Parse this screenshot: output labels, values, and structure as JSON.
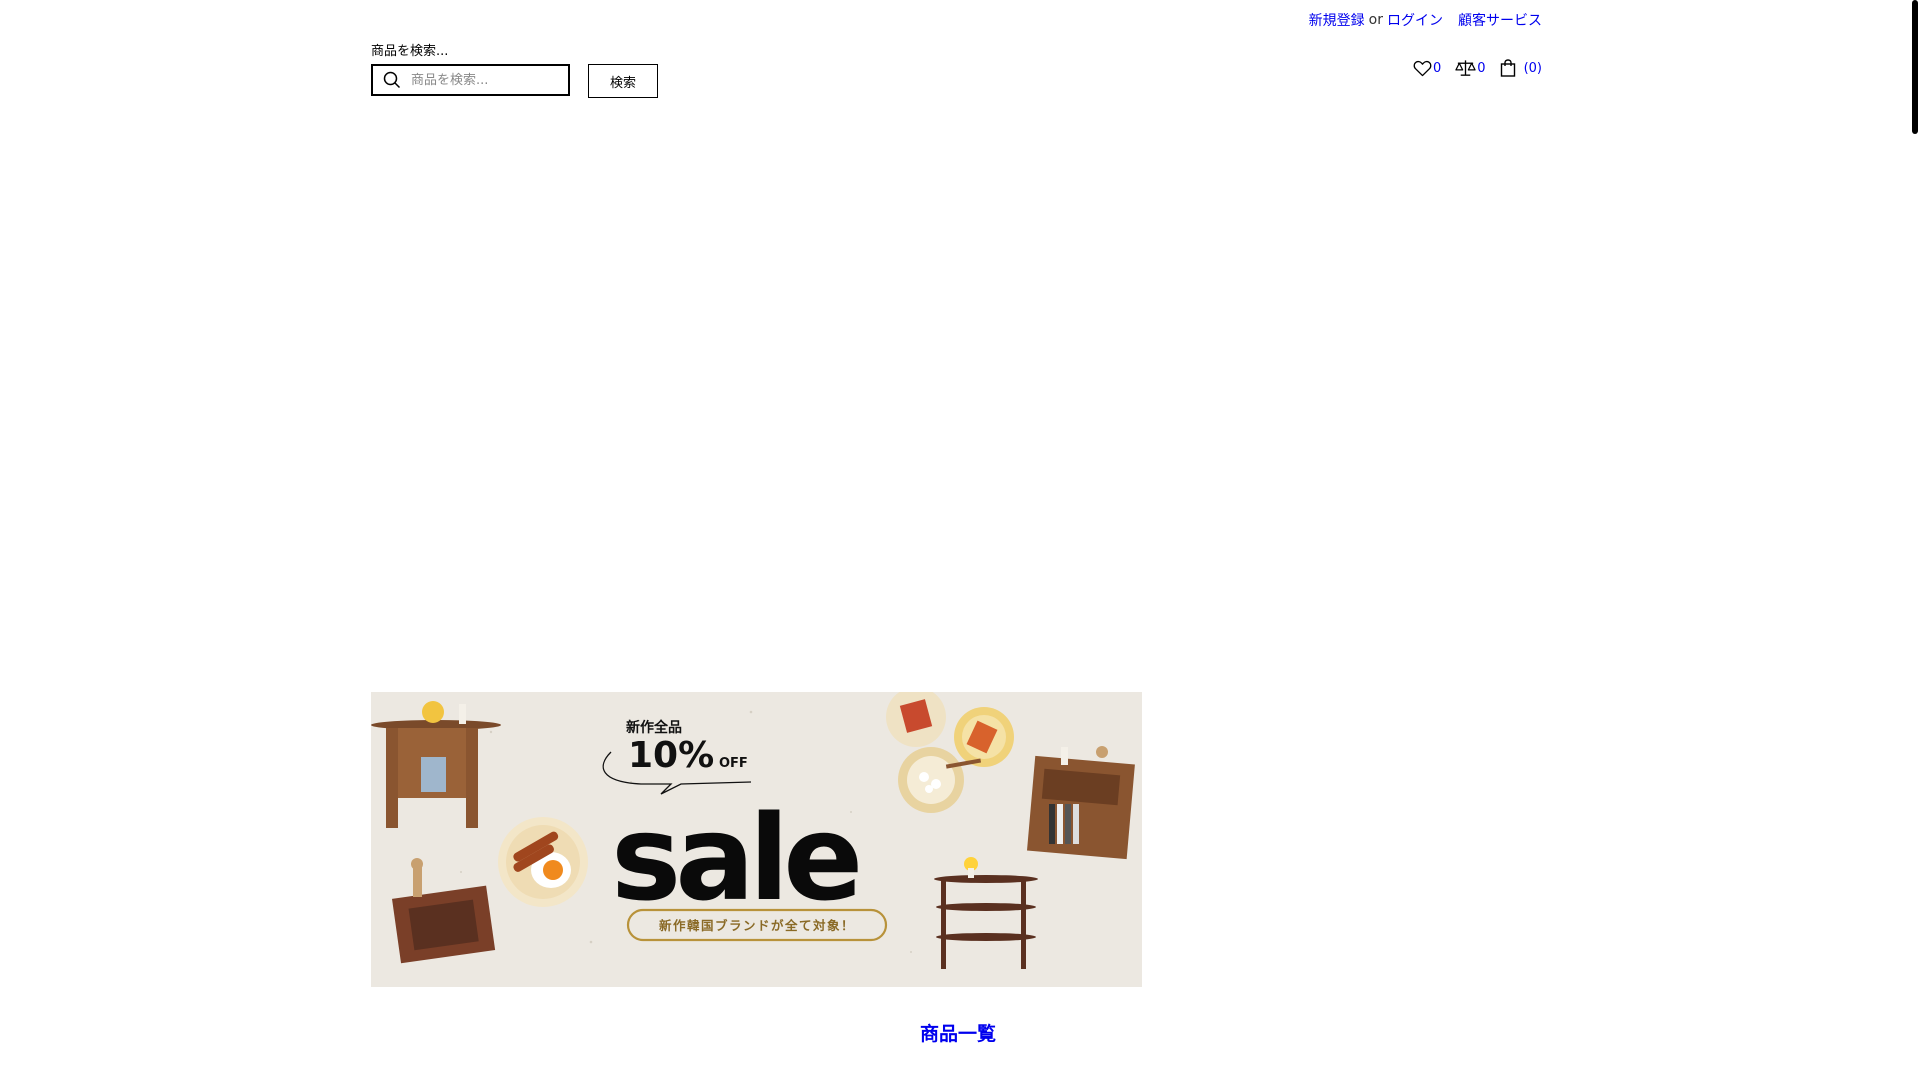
{
  "header": {
    "register_label": "新規登録",
    "or_label": "or",
    "login_label": "ログイン",
    "customer_service_label": "顧客サービス",
    "wishlist_count": "0",
    "compare_count": "0",
    "cart_count": "(0)"
  },
  "search": {
    "label": "商品を検索...",
    "placeholder": "商品を検索...",
    "button_label": "検索"
  },
  "banner": {
    "tagline_top": "新作全品",
    "discount": "10%",
    "off": "OFF",
    "headline": "sale",
    "subline": "新作韓国ブランドが全て対象！"
  },
  "products_heading": "商品一覧",
  "icons": {
    "search": "search-icon",
    "wishlist": "heart-icon",
    "compare": "scale-icon",
    "cart": "shopping-bag-icon"
  },
  "colors": {
    "link": "#0000ee",
    "banner_bg": "#ece8e1",
    "accent_gold": "#b8923a"
  }
}
